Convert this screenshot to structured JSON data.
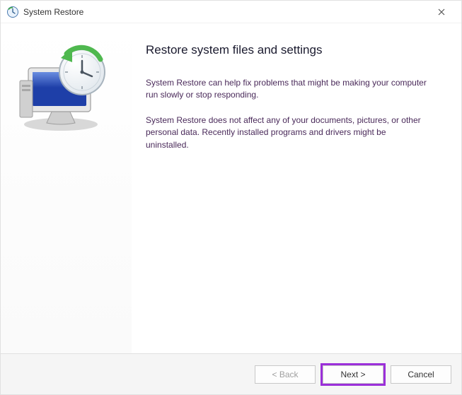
{
  "titlebar": {
    "title": "System Restore"
  },
  "content": {
    "heading": "Restore system files and settings",
    "paragraph1": "System Restore can help fix problems that might be making your computer run slowly or stop responding.",
    "paragraph2": "System Restore does not affect any of your documents, pictures, or other personal data. Recently installed programs and drivers might be uninstalled."
  },
  "footer": {
    "back_label": "< Back",
    "next_label": "Next >",
    "cancel_label": "Cancel"
  }
}
